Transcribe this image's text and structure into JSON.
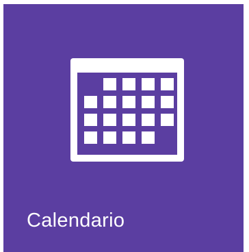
{
  "tile": {
    "label": "Calendario",
    "color": "#5b3ea1",
    "icon": "calendar-icon"
  }
}
